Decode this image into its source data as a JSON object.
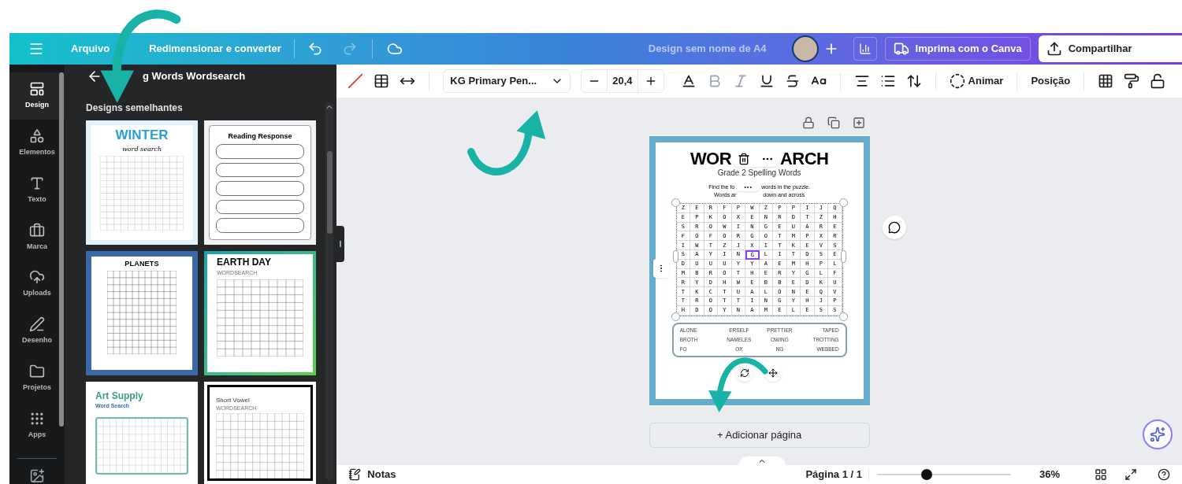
{
  "topbar": {
    "menu": [
      "Arquivo",
      "Redimensionar e converter"
    ],
    "title": "Design sem nome de A4",
    "print_button": "Imprima com o Canva",
    "share_button": "Compartilhar"
  },
  "rail": [
    {
      "label": "Design",
      "kind": "design",
      "selected": true
    },
    {
      "label": "Elementos",
      "kind": "elements",
      "selected": false
    },
    {
      "label": "Texto",
      "kind": "text",
      "selected": false
    },
    {
      "label": "Marca",
      "kind": "brand",
      "selected": false
    },
    {
      "label": "Uploads",
      "kind": "uploads",
      "selected": false
    },
    {
      "label": "Desenho",
      "kind": "draw",
      "selected": false
    },
    {
      "label": "Projetos",
      "kind": "projects",
      "selected": false
    },
    {
      "label": "Apps",
      "kind": "apps",
      "selected": false
    }
  ],
  "panel": {
    "title": "g Words Wordsearch",
    "section": "Designs semelhantes",
    "thumbnails": [
      {
        "kind": "winter",
        "title": "WINTER",
        "subtitle": "word search"
      },
      {
        "kind": "reading",
        "title": "Reading Response"
      },
      {
        "kind": "planets",
        "title": "PLANETS"
      },
      {
        "kind": "earth",
        "title": "EARTH DAY",
        "subtitle": "WORDSEARCH"
      },
      {
        "kind": "art",
        "title": "Art Supply",
        "subtitle": "Word Search"
      },
      {
        "kind": "vowel",
        "title": "Short Vowel",
        "subtitle": "WORDSEARCH"
      }
    ]
  },
  "toolbar": {
    "font": "KG Primary Pen...",
    "size": "20,4",
    "animate": "Animar",
    "position": "Posição"
  },
  "page": {
    "title_left": "WOR",
    "title_right": "ARCH",
    "subtitle": "Grade 2 Spelling Words",
    "instructions": [
      [
        "Find the fo",
        "words in the puzzle."
      ],
      [
        "Words ar",
        "down and across"
      ]
    ],
    "grid": [
      [
        {
          "t": "Z",
          "selected": false
        },
        {
          "t": "E",
          "selected": false
        },
        {
          "t": "R",
          "selected": false
        },
        {
          "t": "F",
          "selected": false
        },
        {
          "t": "P",
          "selected": false
        },
        {
          "t": "W",
          "selected": false
        },
        {
          "t": "Z",
          "selected": false
        },
        {
          "t": "P",
          "selected": false
        },
        {
          "t": "P",
          "selected": false
        },
        {
          "t": "I",
          "selected": false
        },
        {
          "t": "J",
          "selected": false
        },
        {
          "t": "Q",
          "selected": false
        }
      ],
      [
        {
          "t": "E",
          "selected": false
        },
        {
          "t": "P",
          "selected": false
        },
        {
          "t": "K",
          "selected": false
        },
        {
          "t": "O",
          "selected": false
        },
        {
          "t": "X",
          "selected": false
        },
        {
          "t": "E",
          "selected": false
        },
        {
          "t": "N",
          "selected": false
        },
        {
          "t": "R",
          "selected": false
        },
        {
          "t": "D",
          "selected": false
        },
        {
          "t": "T",
          "selected": false
        },
        {
          "t": "Z",
          "selected": false
        },
        {
          "t": "H",
          "selected": false
        }
      ],
      [
        {
          "t": "S",
          "selected": false
        },
        {
          "t": "R",
          "selected": false
        },
        {
          "t": "O",
          "selected": false
        },
        {
          "t": "W",
          "selected": false
        },
        {
          "t": "I",
          "selected": false
        },
        {
          "t": "N",
          "selected": false
        },
        {
          "t": "G",
          "selected": false
        },
        {
          "t": "E",
          "selected": false
        },
        {
          "t": "U",
          "selected": false
        },
        {
          "t": "A",
          "selected": false
        },
        {
          "t": "R",
          "selected": false
        },
        {
          "t": "E",
          "selected": false
        }
      ],
      [
        {
          "t": "F",
          "selected": false
        },
        {
          "t": "O",
          "selected": false
        },
        {
          "t": "F",
          "selected": false
        },
        {
          "t": "O",
          "selected": false
        },
        {
          "t": "R",
          "selected": false
        },
        {
          "t": "G",
          "selected": false
        },
        {
          "t": "O",
          "selected": false
        },
        {
          "t": "T",
          "selected": false
        },
        {
          "t": "M",
          "selected": false
        },
        {
          "t": "P",
          "selected": false
        },
        {
          "t": "X",
          "selected": false
        },
        {
          "t": "R",
          "selected": false
        }
      ],
      [
        {
          "t": "I",
          "selected": false
        },
        {
          "t": "W",
          "selected": false
        },
        {
          "t": "T",
          "selected": false
        },
        {
          "t": "Z",
          "selected": false
        },
        {
          "t": "J",
          "selected": false
        },
        {
          "t": "X",
          "selected": false
        },
        {
          "t": "I",
          "selected": false
        },
        {
          "t": "T",
          "selected": false
        },
        {
          "t": "K",
          "selected": false
        },
        {
          "t": "E",
          "selected": false
        },
        {
          "t": "V",
          "selected": false
        },
        {
          "t": "S",
          "selected": false
        }
      ],
      [
        {
          "t": "S",
          "selected": false
        },
        {
          "t": "A",
          "selected": false
        },
        {
          "t": "Y",
          "selected": false
        },
        {
          "t": "I",
          "selected": false
        },
        {
          "t": "N",
          "selected": false
        },
        {
          "t": "G",
          "selected": true
        },
        {
          "t": "L",
          "selected": false
        },
        {
          "t": "I",
          "selected": false
        },
        {
          "t": "T",
          "selected": false
        },
        {
          "t": "D",
          "selected": false
        },
        {
          "t": "S",
          "selected": false
        },
        {
          "t": "E",
          "selected": false
        }
      ],
      [
        {
          "t": "D",
          "selected": false
        },
        {
          "t": "U",
          "selected": false
        },
        {
          "t": "U",
          "selected": false
        },
        {
          "t": "U",
          "selected": false
        },
        {
          "t": "Y",
          "selected": false
        },
        {
          "t": "Y",
          "selected": false
        },
        {
          "t": "A",
          "selected": false
        },
        {
          "t": "E",
          "selected": false
        },
        {
          "t": "M",
          "selected": false
        },
        {
          "t": "H",
          "selected": false
        },
        {
          "t": "P",
          "selected": false
        },
        {
          "t": "L",
          "selected": false
        }
      ],
      [
        {
          "t": "M",
          "selected": false
        },
        {
          "t": "B",
          "selected": false
        },
        {
          "t": "R",
          "selected": false
        },
        {
          "t": "O",
          "selected": false
        },
        {
          "t": "T",
          "selected": false
        },
        {
          "t": "H",
          "selected": false
        },
        {
          "t": "E",
          "selected": false
        },
        {
          "t": "R",
          "selected": false
        },
        {
          "t": "Y",
          "selected": false
        },
        {
          "t": "G",
          "selected": false
        },
        {
          "t": "L",
          "selected": false
        },
        {
          "t": "F",
          "selected": false
        }
      ],
      [
        {
          "t": "R",
          "selected": false
        },
        {
          "t": "Y",
          "selected": false
        },
        {
          "t": "D",
          "selected": false
        },
        {
          "t": "H",
          "selected": false
        },
        {
          "t": "W",
          "selected": false
        },
        {
          "t": "E",
          "selected": false
        },
        {
          "t": "B",
          "selected": false
        },
        {
          "t": "B",
          "selected": false
        },
        {
          "t": "E",
          "selected": false
        },
        {
          "t": "D",
          "selected": false
        },
        {
          "t": "K",
          "selected": false
        },
        {
          "t": "U",
          "selected": false
        }
      ],
      [
        {
          "t": "T",
          "selected": false
        },
        {
          "t": "K",
          "selected": false
        },
        {
          "t": "C",
          "selected": false
        },
        {
          "t": "T",
          "selected": false
        },
        {
          "t": "U",
          "selected": false
        },
        {
          "t": "A",
          "selected": false
        },
        {
          "t": "L",
          "selected": false
        },
        {
          "t": "O",
          "selected": false
        },
        {
          "t": "N",
          "selected": false
        },
        {
          "t": "E",
          "selected": false
        },
        {
          "t": "Q",
          "selected": false
        },
        {
          "t": "V",
          "selected": false
        }
      ],
      [
        {
          "t": "T",
          "selected": false
        },
        {
          "t": "R",
          "selected": false
        },
        {
          "t": "O",
          "selected": false
        },
        {
          "t": "T",
          "selected": false
        },
        {
          "t": "T",
          "selected": false
        },
        {
          "t": "I",
          "selected": false
        },
        {
          "t": "N",
          "selected": false
        },
        {
          "t": "G",
          "selected": false
        },
        {
          "t": "Y",
          "selected": false
        },
        {
          "t": "H",
          "selected": false
        },
        {
          "t": "J",
          "selected": false
        },
        {
          "t": "P",
          "selected": false
        }
      ],
      [
        {
          "t": "H",
          "selected": false
        },
        {
          "t": "D",
          "selected": false
        },
        {
          "t": "O",
          "selected": false
        },
        {
          "t": "Y",
          "selected": false
        },
        {
          "t": "N",
          "selected": false
        },
        {
          "t": "A",
          "selected": false
        },
        {
          "t": "M",
          "selected": false
        },
        {
          "t": "E",
          "selected": false
        },
        {
          "t": "L",
          "selected": false
        },
        {
          "t": "E",
          "selected": false
        },
        {
          "t": "S",
          "selected": false
        },
        {
          "t": "S",
          "selected": false
        }
      ]
    ],
    "word_list": [
      [
        "ALONE",
        "ERSELF",
        "PRETTIER",
        "TAPED"
      ],
      [
        "BROTH",
        "NAMELES",
        "OWING",
        "TROTTING"
      ],
      [
        "FO",
        "OX",
        "NG",
        "WEBBED"
      ]
    ]
  },
  "add_page": "+ Adicionar página",
  "statusbar": {
    "notes": "Notas",
    "page": "Página 1 / 1",
    "zoom": {
      "level": 0.37
    },
    "zoom_reading": "36%"
  }
}
